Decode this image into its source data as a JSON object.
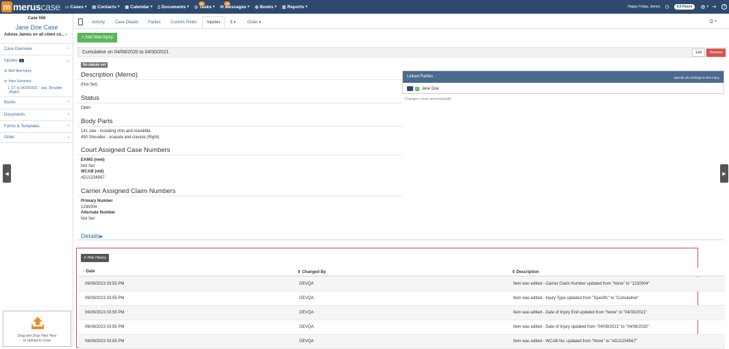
{
  "brand": {
    "m": "m",
    "name_bold": "merus",
    "name_light": "case"
  },
  "nav": [
    {
      "label": "Cases",
      "icon": "folder-icon"
    },
    {
      "label": "Contacts",
      "icon": "contacts-icon"
    },
    {
      "label": "Calendar",
      "icon": "calendar-icon"
    },
    {
      "label": "Documents",
      "icon": "document-icon"
    },
    {
      "label": "Tasks",
      "icon": "tasks-icon",
      "badge": "34"
    },
    {
      "label": "Messages",
      "icon": "mail-icon",
      "badge": "31"
    },
    {
      "label": "Books",
      "icon": "books-icon"
    },
    {
      "label": "Reports",
      "icon": "chart-icon"
    }
  ],
  "topright": {
    "greeting": "Happy Friday, James.",
    "hours": "0.0 Hours"
  },
  "sidebar": {
    "case_number": "Case 556",
    "case_name": "Jane Doe Case",
    "advise": "Advise James on all client co...",
    "overview": "Case Overview",
    "injuries": "Injuries",
    "injuries_count": "1",
    "add_injury": "Add New Injury",
    "view_summary": "View Summary",
    "injury_line1": "1. CT to 04/30/2021 - Jaw, Shoulder",
    "injury_line2": "(Right)",
    "books": "Books",
    "documents": "Documents",
    "forms": "Forms & Templates",
    "order": "Order",
    "upload_line1": "Drag and Drop Files Here",
    "upload_line2": "to Upload to Case"
  },
  "tabs": {
    "activity": "Activity",
    "case_details": "Case Details",
    "parties": "Parties",
    "custom_fields": "Custom Fields",
    "injuries": "Injuries",
    "dollar": "$",
    "order": "Order"
  },
  "main": {
    "add_button": "+ Add New Injury",
    "cumulative": "Cumulative on 04/08/2020 to 04/30/2021",
    "edit": "Edit",
    "remove": "Remove",
    "statute": "No statute set",
    "desc_title": "Description (Memo)",
    "desc_val": "(Not Set)",
    "status_title": "Status",
    "status_val": "Open",
    "body_title": "Body Parts",
    "body_1": "141 Jaw - including chin and mandible",
    "body_2": "450 Shoulder - scapula and clavicle (Right)",
    "court_title": "Court Assigned Case Numbers",
    "eams_label": "EAMS (new)",
    "eams_val": "Not Set",
    "wcab_label": "WCAB (old)",
    "wcab_val": "ADJ1234567",
    "carrier_title": "Carrier Assigned Claim Numbers",
    "primary_label": "Primary Number",
    "primary_val": "1230004",
    "alt_label": "Alternate Number",
    "alt_val": "Not Set",
    "details": "Details"
  },
  "linked": {
    "title": "Linked Parties",
    "hint": "Specify who belongs to this injury",
    "party": "Jane Doe",
    "note": "Changes save automatically"
  },
  "history": {
    "button": "Hide History",
    "headers": {
      "date": "Date",
      "changed_by": "Changed By",
      "description": "Description"
    },
    "rows": [
      {
        "date": "06/09/2023 03:55 PM",
        "by": "DEVQA",
        "desc": "Item was edited - Carrier Claim Number updated from \"None\" to \"1230004\""
      },
      {
        "date": "06/09/2023 03:55 PM",
        "by": "DEVQA",
        "desc": "Item was edited - Injury Type updated from \"Specific\" to \"Cumulative\""
      },
      {
        "date": "06/09/2023 03:55 PM",
        "by": "DEVQA",
        "desc": "Item was edited - Date of Injury End updated from \"None\" to \"04/30/2021\""
      },
      {
        "date": "06/09/2023 03:55 PM",
        "by": "DEVQA",
        "desc": "Item was edited - Date of Injury updated from \"04/09/2021\" to \"04/08/2020\""
      },
      {
        "date": "06/09/2023 03:55 PM",
        "by": "DEVQA",
        "desc": "Item was edited - WCAB No. updated from \"None\" to \"ADJ1234567\""
      }
    ]
  }
}
